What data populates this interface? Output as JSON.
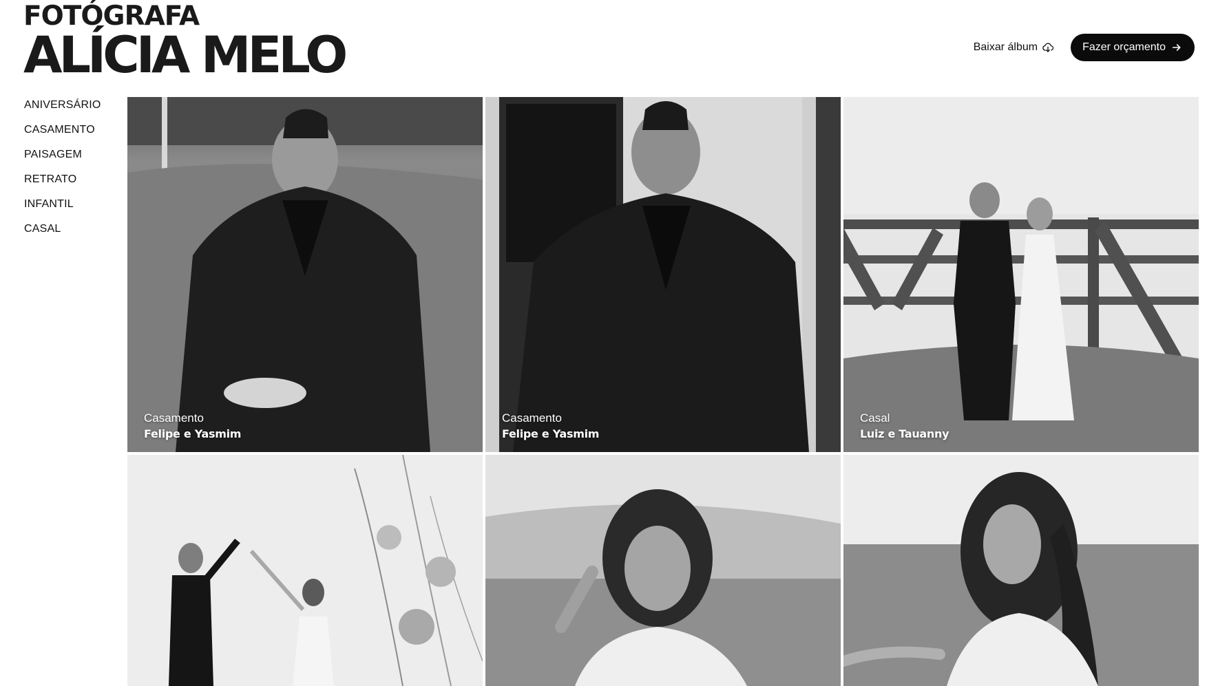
{
  "header": {
    "logo_line1": "FOTÓGRAFA",
    "logo_line2": "ALÍCIA MELO",
    "download_label": "Baixar álbum",
    "download_icon": "cloud-download-icon",
    "quote_label": "Fazer orçamento",
    "quote_icon": "arrow-right-icon"
  },
  "sidebar": {
    "items": [
      {
        "label": "ANIVERSÁRIO"
      },
      {
        "label": "CASAMENTO"
      },
      {
        "label": "PAISAGEM"
      },
      {
        "label": "RETRATO"
      },
      {
        "label": "INFANTIL"
      },
      {
        "label": "CASAL"
      }
    ]
  },
  "gallery": {
    "items": [
      {
        "category": "Casamento",
        "title": "Felipe e Yasmim"
      },
      {
        "category": "Casamento",
        "title": "Felipe e Yasmim"
      },
      {
        "category": "Casal",
        "title": "Luiz e Tauanny"
      },
      {
        "category": "",
        "title": ""
      },
      {
        "category": "",
        "title": ""
      },
      {
        "category": "",
        "title": ""
      }
    ]
  },
  "colors": {
    "button_bg": "#0b0b0b",
    "text": "#111111"
  }
}
